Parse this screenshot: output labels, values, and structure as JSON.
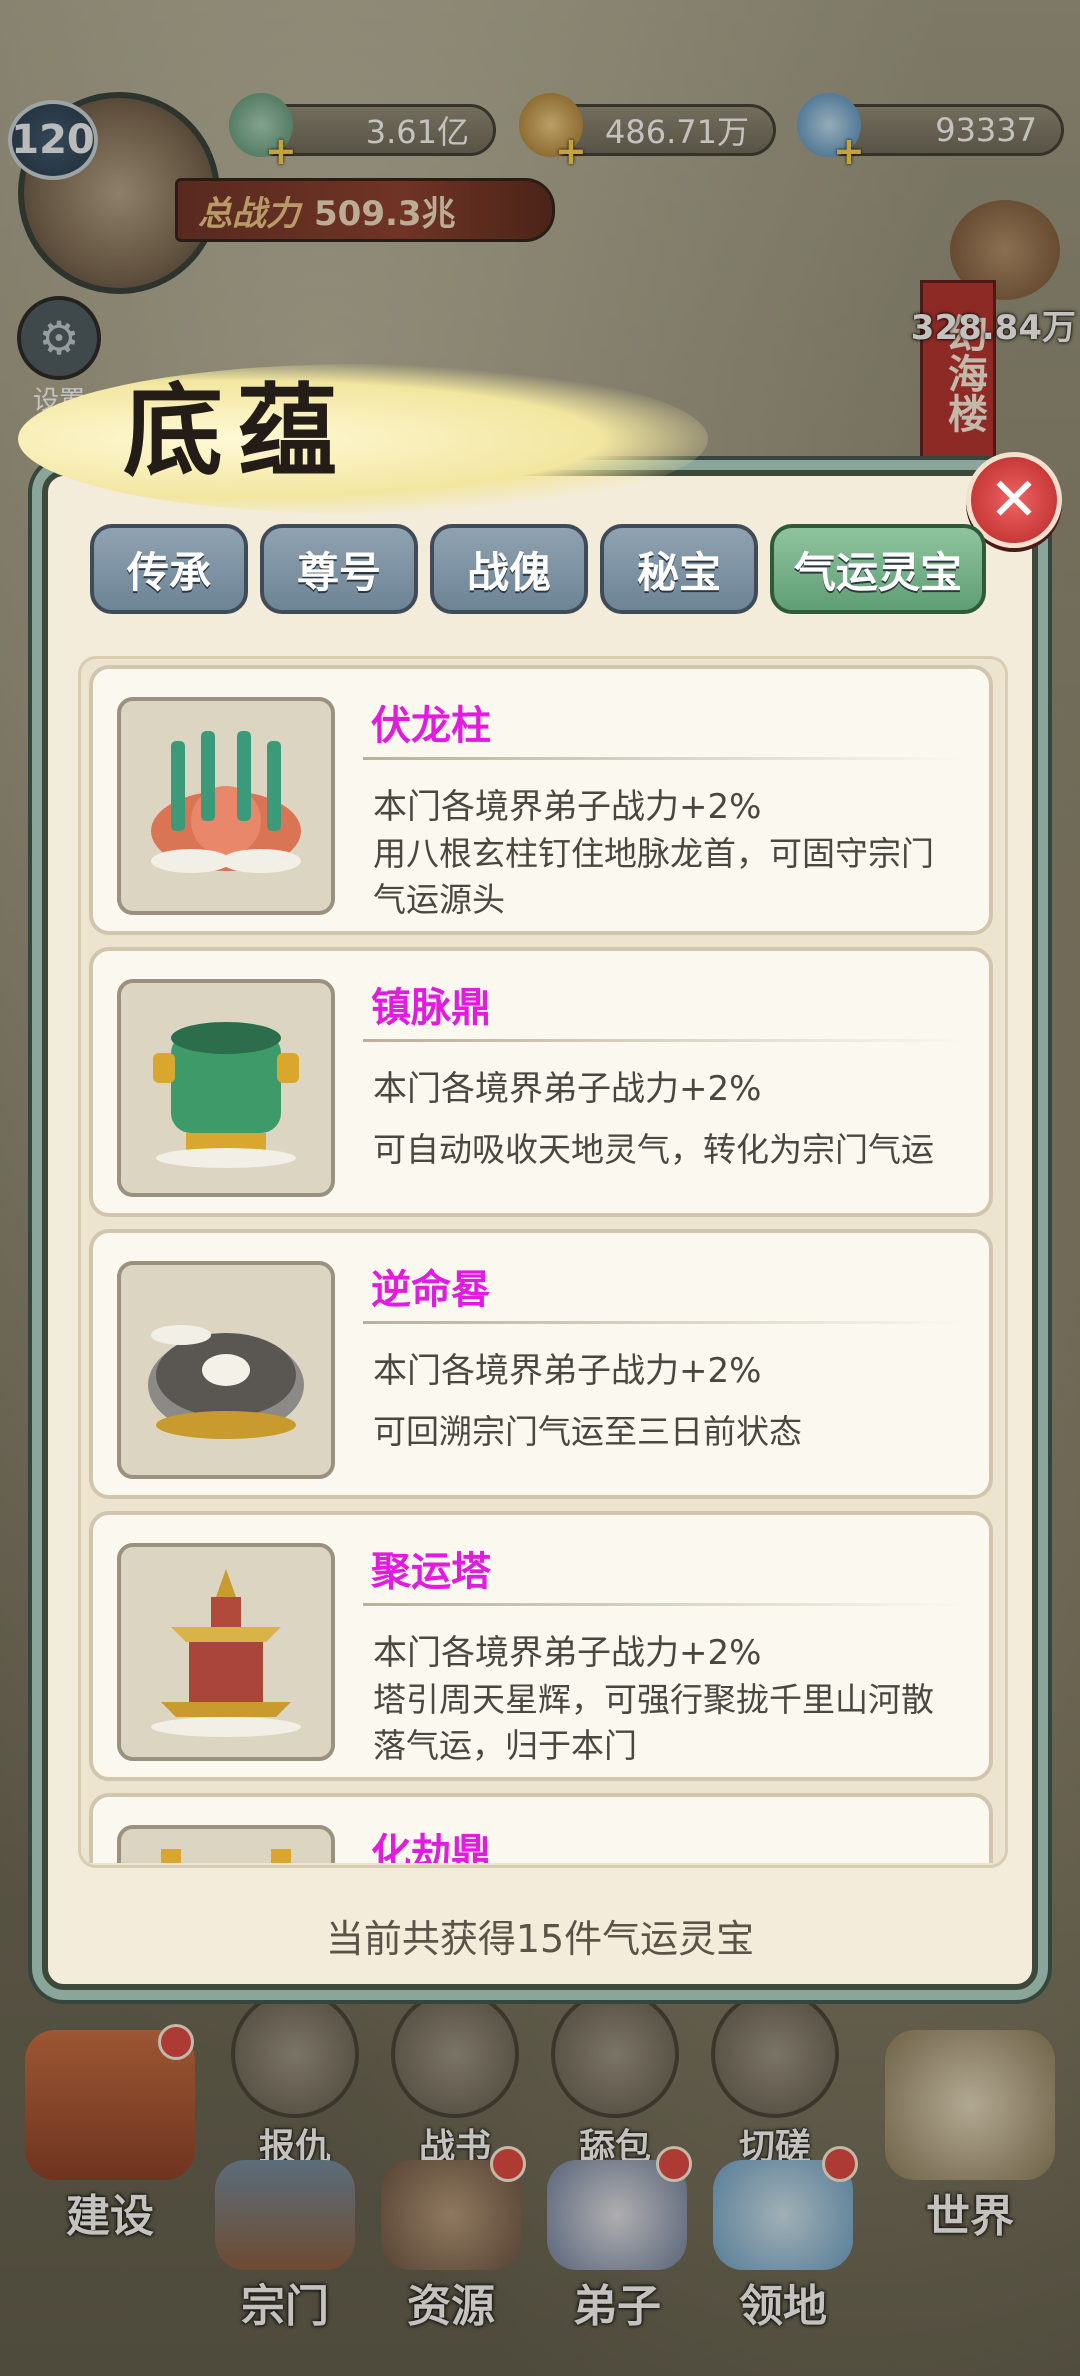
{
  "hud": {
    "level": "120",
    "power_label": "总战力",
    "power_value": "509.3兆",
    "resources": [
      {
        "icon": "jade-ore-icon",
        "value": "3.61亿",
        "color": "#7fb59a"
      },
      {
        "icon": "gold-scroll-icon",
        "value": "486.71万",
        "color": "#d9a84a"
      },
      {
        "icon": "blue-crystal-icon",
        "value": "93337",
        "color": "#6fa8d6"
      }
    ],
    "settings_label": "设置",
    "side_building": {
      "name": "幻海楼",
      "value": "328.84万"
    }
  },
  "modal": {
    "title": "底蕴",
    "tabs": [
      {
        "label": "传承",
        "active": false
      },
      {
        "label": "尊号",
        "active": false
      },
      {
        "label": "战傀",
        "active": false
      },
      {
        "label": "秘宝",
        "active": false
      },
      {
        "label": "气运灵宝",
        "active": true
      }
    ],
    "items": [
      {
        "name": "伏龙柱",
        "effect": "本门各境界弟子战力+2%",
        "desc": "用八根玄柱钉住地脉龙首，可固守宗门气运源头",
        "icon": "dragon-pillar-icon"
      },
      {
        "name": "镇脉鼎",
        "effect": "本门各境界弟子战力+2%",
        "desc": "可自动吸收天地灵气，转化为宗门气运",
        "icon": "bronze-cauldron-icon"
      },
      {
        "name": "逆命晷",
        "effect": "本门各境界弟子战力+2%",
        "desc": "可回溯宗门气运至三日前状态",
        "icon": "sundial-icon"
      },
      {
        "name": "聚运塔",
        "effect": "本门各境界弟子战力+2%",
        "desc": "塔引周天星辉，可强行聚拢千里山河散落气运，归于本门",
        "icon": "pagoda-icon"
      },
      {
        "name": "化劫鼎",
        "effect": "",
        "desc": "",
        "icon": "cauldron-icon"
      }
    ],
    "footer": "当前共获得15件气运灵宝"
  },
  "nav": {
    "small": [
      "报仇",
      "战书",
      "舔包",
      "切磋"
    ],
    "big": [
      "建设",
      "宗门",
      "资源",
      "弟子",
      "领地",
      "世界"
    ]
  }
}
